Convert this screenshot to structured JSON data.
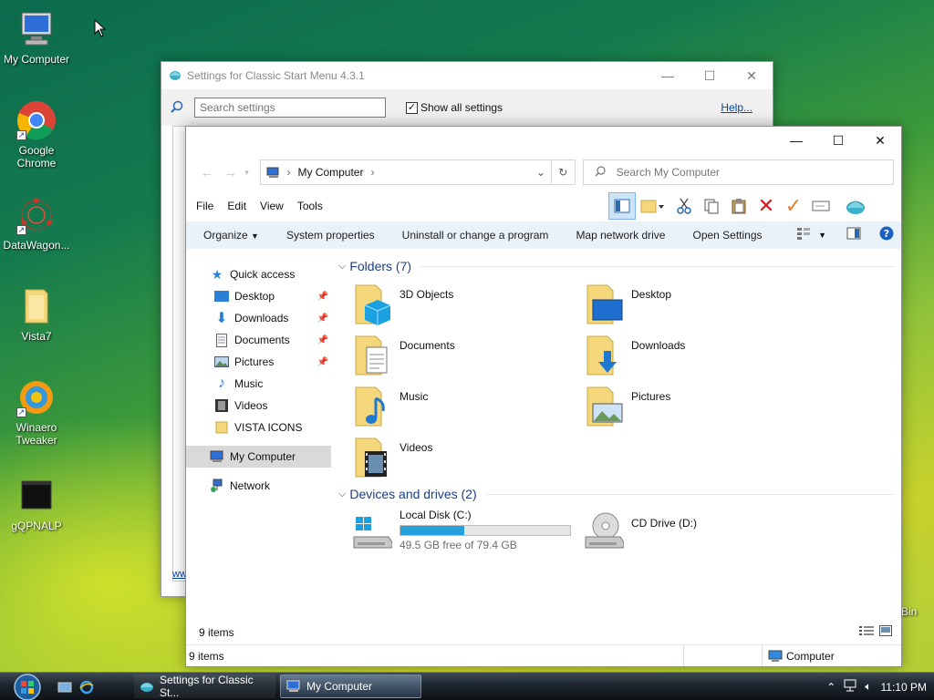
{
  "desktop": {
    "icons": [
      {
        "label": "My Computer"
      },
      {
        "label": "Google Chrome"
      },
      {
        "label": "DataWagon..."
      },
      {
        "label": "Vista7"
      },
      {
        "label": "Winaero Tweaker"
      },
      {
        "label": "gQPNALP"
      }
    ],
    "partial_label": "Bin"
  },
  "settings_window": {
    "title": "Settings for Classic Start Menu 4.3.1",
    "search_placeholder": "Search settings",
    "show_all_label": "Show all settings",
    "show_all_checked": true,
    "help_label": "Help...",
    "footer_link": "ww"
  },
  "explorer": {
    "address_crumb": "My Computer",
    "search_placeholder": "Search My Computer",
    "menu": [
      "File",
      "Edit",
      "View",
      "Tools"
    ],
    "commands": [
      "Organize",
      "System properties",
      "Uninstall or change a program",
      "Map network drive",
      "Open Settings"
    ],
    "nav": {
      "quick_access": "Quick access",
      "items": [
        {
          "label": "Desktop",
          "pinned": true
        },
        {
          "label": "Downloads",
          "pinned": true
        },
        {
          "label": "Documents",
          "pinned": true
        },
        {
          "label": "Pictures",
          "pinned": true
        },
        {
          "label": "Music",
          "pinned": false
        },
        {
          "label": "Videos",
          "pinned": false
        },
        {
          "label": "VISTA ICONS",
          "pinned": false
        }
      ],
      "my_computer": "My Computer",
      "network": "Network"
    },
    "folders_header": "Folders (7)",
    "folders": [
      "3D Objects",
      "Desktop",
      "Documents",
      "Downloads",
      "Music",
      "Pictures",
      "Videos"
    ],
    "devices_header": "Devices and drives (2)",
    "drives": [
      {
        "label": "Local Disk (C:)",
        "free_text": "49.5 GB free of 79.4 GB",
        "used_fraction": 0.377
      },
      {
        "label": "CD Drive (D:)"
      }
    ],
    "items_inner": "9 items",
    "status_items": "9 items",
    "status_location": "Computer"
  },
  "taskbar": {
    "tasks": [
      "Settings for Classic St...",
      "My Computer"
    ],
    "clock": "11:10 PM"
  },
  "colors": {
    "accent": "#26a0da",
    "link": "#0645ad",
    "group_header": "#1e3e84"
  }
}
